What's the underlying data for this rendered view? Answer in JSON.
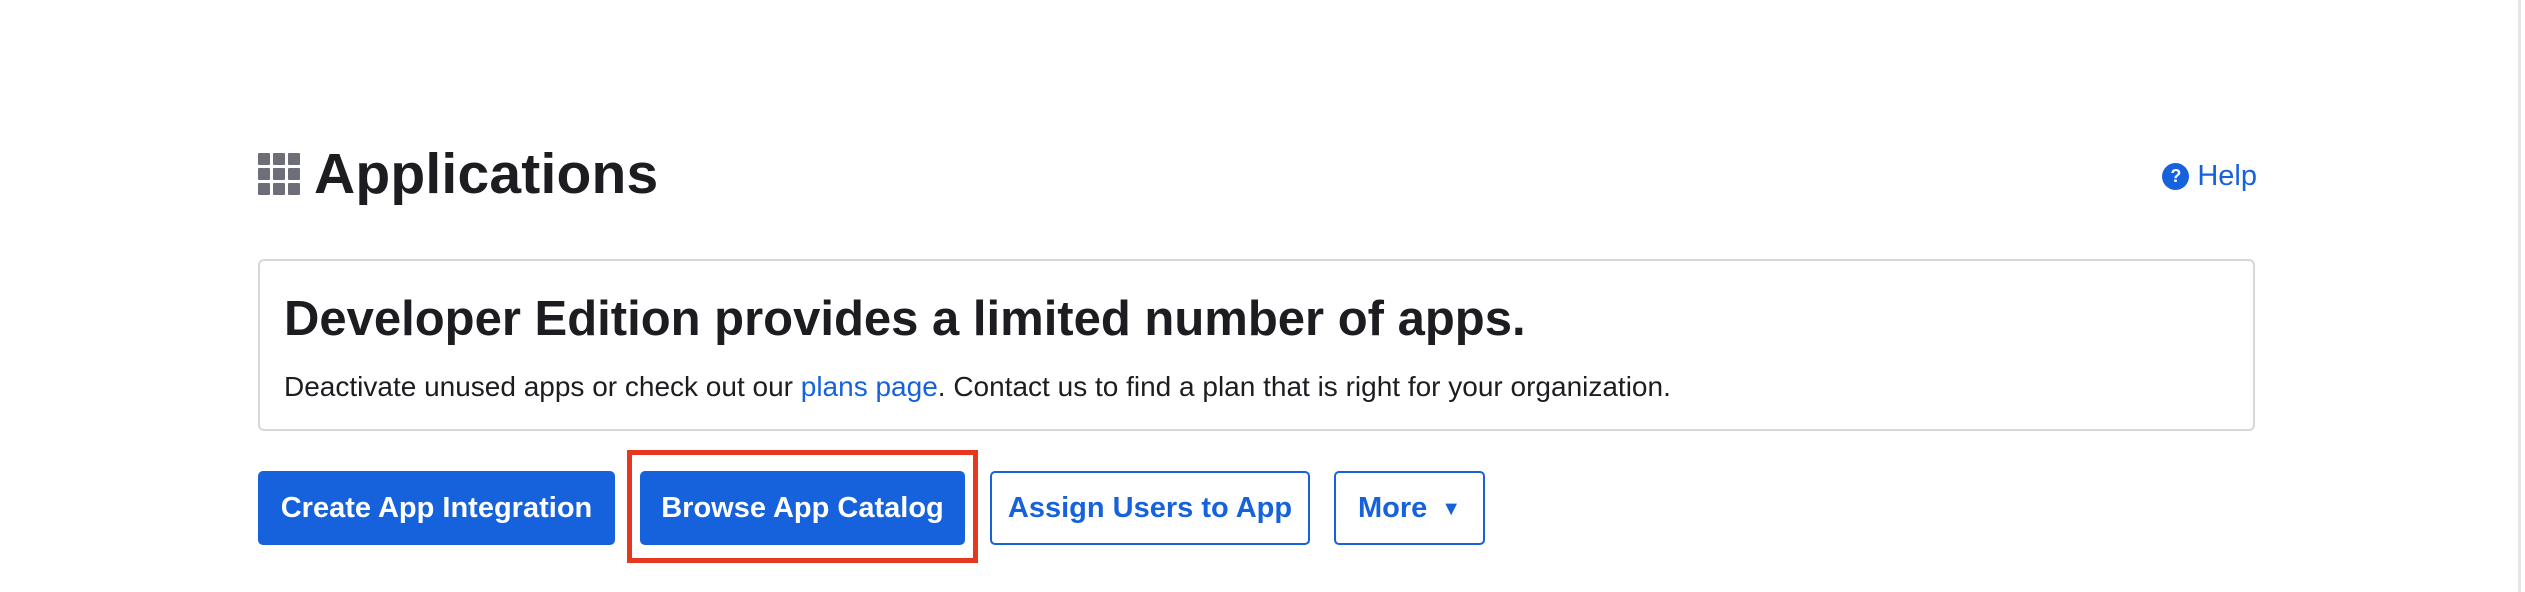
{
  "header": {
    "title": "Applications",
    "icon": "apps-grid-icon",
    "help": {
      "label": "Help",
      "icon_glyph": "?",
      "icon": "question-circle-icon"
    }
  },
  "notice": {
    "heading": "Developer Edition provides a limited number of apps.",
    "body_before": "Deactivate unused apps or check out our ",
    "link_text": "plans page",
    "body_after": ". Contact us to find a plan that is right for your organization."
  },
  "actions": {
    "create_label": "Create App Integration",
    "browse_label": "Browse App Catalog",
    "assign_label": "Assign Users to App",
    "more_label": "More",
    "more_icon_glyph": "▼"
  },
  "colors": {
    "accent": "#1662dd",
    "highlight": "#e5381e",
    "text": "#1d1d21",
    "panel_border": "#d7d7dc"
  }
}
